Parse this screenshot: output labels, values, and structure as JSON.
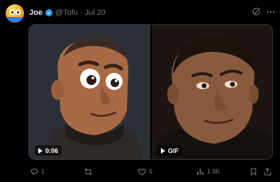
{
  "author": {
    "name": "Joe",
    "handle": "@Tofu",
    "separator": "·",
    "date": "Jul 20",
    "verified": true
  },
  "header_icons": [
    "grok-icon",
    "more-options-icon"
  ],
  "media": [
    {
      "kind": "video",
      "badge": "0:06",
      "description_icon": "play-icon"
    },
    {
      "kind": "gif",
      "badge": "GIF",
      "description_icon": "play-icon"
    }
  ],
  "actions": {
    "reply_count": "1",
    "repost_count": "",
    "like_count": "6",
    "views_count": "1.8K"
  },
  "colors": {
    "background": "#000000",
    "text_primary": "#e7e9ea",
    "text_secondary": "#71767b",
    "verified_blue": "#1d9bf0",
    "border": "#2f3336"
  }
}
